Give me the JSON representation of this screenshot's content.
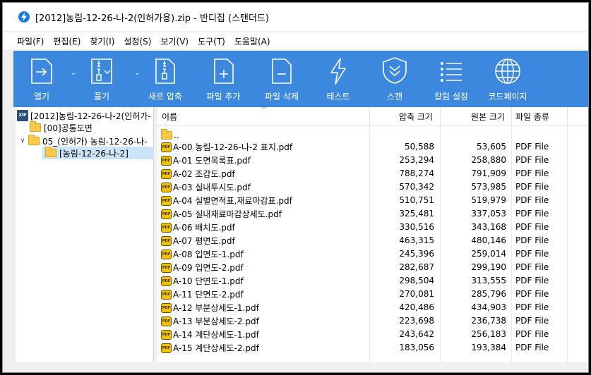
{
  "window": {
    "title": "[2012]농림-12-26-나-2(인허가용).zip - 반디집 (스탠더드)"
  },
  "menu": [
    "파일(F)",
    "편집(E)",
    "찾기(I)",
    "설정(S)",
    "보기(V)",
    "도구(T)",
    "도움말(A)"
  ],
  "toolbar": {
    "open": "열기",
    "extract": "풀기",
    "new_archive": "새로 압축",
    "add_file": "파일 추가",
    "delete_file": "파일 삭제",
    "test": "테스트",
    "scan": "스캔",
    "column_settings": "칼럼 설정",
    "codepage": "코드페이지"
  },
  "tree": {
    "root": "[2012]농림-12-26-나-2(인허가-",
    "folder1": "[00]공통도면",
    "folder2": "05_(인허가) 농림-12-26-나-",
    "folder3": "[농림-12-26-나-2]"
  },
  "list": {
    "headers": {
      "name": "이름",
      "compressed": "압축 크기",
      "original": "원본 크기",
      "type": "파일 종류"
    },
    "parent": "..",
    "rows": [
      {
        "name": "A-00 농림-12-26-나-2 표지.pdf",
        "compressed": "50,588",
        "original": "53,605",
        "type": "PDF File"
      },
      {
        "name": "A-01 도면목록표.pdf",
        "compressed": "253,294",
        "original": "258,880",
        "type": "PDF File"
      },
      {
        "name": "A-02 조감도.pdf",
        "compressed": "788,274",
        "original": "791,909",
        "type": "PDF File"
      },
      {
        "name": "A-03 실내투시도.pdf",
        "compressed": "570,342",
        "original": "573,985",
        "type": "PDF File"
      },
      {
        "name": "A-04 실별면적표,재료마감표.pdf",
        "compressed": "510,751",
        "original": "519,979",
        "type": "PDF File"
      },
      {
        "name": "A-05 실내재료마감상세도.pdf",
        "compressed": "325,481",
        "original": "337,053",
        "type": "PDF File"
      },
      {
        "name": "A-06 배치도.pdf",
        "compressed": "330,516",
        "original": "343,168",
        "type": "PDF File"
      },
      {
        "name": "A-07 평면도.pdf",
        "compressed": "463,315",
        "original": "480,146",
        "type": "PDF File"
      },
      {
        "name": "A-08 입면도-1.pdf",
        "compressed": "245,396",
        "original": "259,014",
        "type": "PDF File"
      },
      {
        "name": "A-09 입면도-2.pdf",
        "compressed": "282,687",
        "original": "299,190",
        "type": "PDF File"
      },
      {
        "name": "A-10 단면도-1.pdf",
        "compressed": "298,504",
        "original": "313,555",
        "type": "PDF File"
      },
      {
        "name": "A-11 단면도-2.pdf",
        "compressed": "270,081",
        "original": "285,796",
        "type": "PDF File"
      },
      {
        "name": "A-12 부분상세도-1.pdf",
        "compressed": "420,486",
        "original": "434,903",
        "type": "PDF File"
      },
      {
        "name": "A-13 부분상세도-2.pdf",
        "compressed": "223,698",
        "original": "236,738",
        "type": "PDF File"
      },
      {
        "name": "A-14 계단상세도-1.pdf",
        "compressed": "243,642",
        "original": "256,183",
        "type": "PDF File"
      },
      {
        "name": "A-15 계단상세도-2.pdf",
        "compressed": "183,056",
        "original": "193,384",
        "type": "PDF File"
      }
    ]
  },
  "icons": {
    "pdf_badge": "PDF",
    "zip_badge": "ZIP"
  },
  "colors": {
    "toolbar": "#3c88df",
    "selection": "#cce4f7",
    "folder": "#f7c948"
  }
}
